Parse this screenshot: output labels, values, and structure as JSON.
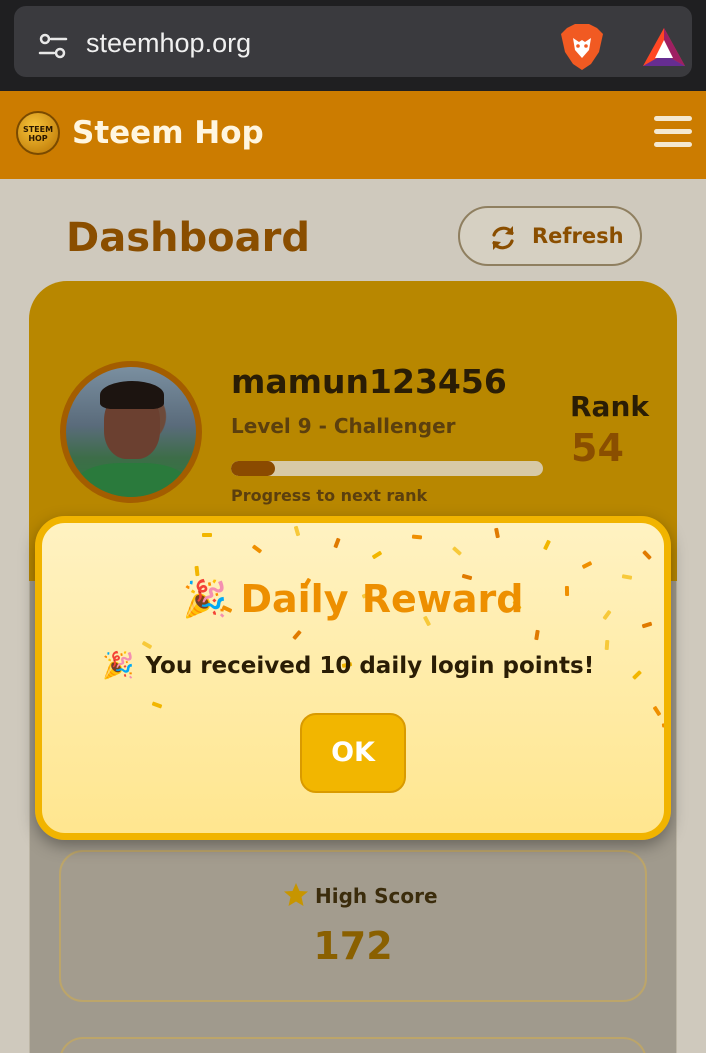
{
  "browser": {
    "url": "steemhop.org",
    "icons": [
      "tune-icon",
      "brave-lion-icon",
      "bat-triangle-icon"
    ]
  },
  "header": {
    "logo_text": "STEEM HOP",
    "title": "Steem Hop",
    "menu_icon": "hamburger-menu-icon"
  },
  "dashboard": {
    "title": "Dashboard",
    "refresh_label": "Refresh",
    "refresh_icon": "refresh-icon"
  },
  "profile": {
    "username": "mamun123456",
    "level": "Level 9 - Challenger",
    "progress_fraction": 0.14,
    "progress_caption": "Progress to next rank",
    "rank_label": "Rank",
    "rank_value": "54"
  },
  "stats": {
    "high_score_label": "High Score",
    "high_score_value": "172",
    "high_score_icon": "star-icon"
  },
  "modal": {
    "title_icon": "🎉",
    "title": "Daily Reward",
    "message_icon": "🎉",
    "message": "You received 10 daily login points!",
    "ok_label": "OK"
  },
  "colors": {
    "accent": "#ed8f00",
    "header_bg": "#cc7c00",
    "modal_border": "#f1b400",
    "brown_text": "#8a4e00"
  }
}
